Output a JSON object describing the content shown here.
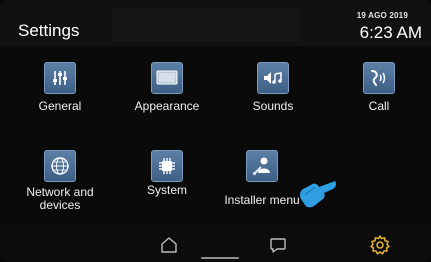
{
  "header": {
    "title": "Settings",
    "date": "19 AGO 2019",
    "time": "6:23 AM"
  },
  "tiles": [
    {
      "label": "General",
      "icon": "sliders-icon"
    },
    {
      "label": "Appearance",
      "icon": "display-icon"
    },
    {
      "label": "Sounds",
      "icon": "speaker-music-icon"
    },
    {
      "label": "Call",
      "icon": "ringing-handset-icon"
    },
    {
      "label": "Network and devices",
      "icon": "globe-icon"
    },
    {
      "label": "System",
      "icon": "chip-icon"
    },
    {
      "label": "Installer menu",
      "icon": "installer-tools-icon"
    }
  ],
  "navbar": {
    "items": [
      "home-icon",
      "message-icon",
      "settings-gear-icon"
    ],
    "active_color": "#e8b43a"
  },
  "colors": {
    "icon_blue": "#4d6f96",
    "accent_cursor": "#2e9ee0"
  }
}
